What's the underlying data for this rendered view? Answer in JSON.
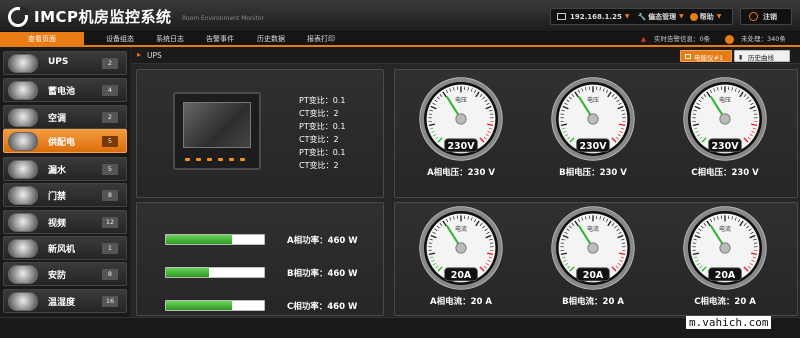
{
  "app": {
    "title": "IMCP机房监控系统",
    "subtitle": "Room Environment Monitor"
  },
  "topbar": {
    "ip": "192.168.1.25",
    "ip_arrow": "▼",
    "settings": "偏态管理",
    "settings_arrow": "▼",
    "help": "帮助",
    "help_arrow": "▼",
    "logout": "注销"
  },
  "nav": {
    "items": [
      "查看页面",
      "设备组态",
      "系统日志",
      "告警事件",
      "历史数据",
      "报表打印"
    ]
  },
  "alarm": {
    "realtime": "实时告警信息：0条",
    "unhandled": "未处理：340条"
  },
  "sidebar": {
    "items": [
      {
        "label": "UPS",
        "count": "2"
      },
      {
        "label": "蓄电池",
        "count": "4"
      },
      {
        "label": "空调",
        "count": "2"
      },
      {
        "label": "供配电",
        "count": "5"
      },
      {
        "label": "漏水",
        "count": "5"
      },
      {
        "label": "门禁",
        "count": "8"
      },
      {
        "label": "视频",
        "count": "12"
      },
      {
        "label": "新风机",
        "count": "1"
      },
      {
        "label": "安防",
        "count": "8"
      },
      {
        "label": "温湿度",
        "count": "16"
      }
    ]
  },
  "breadcrumb": {
    "arrow": "▸",
    "title": "UPS",
    "meter_tab": "电能仪#1",
    "history_tab": "历史曲线"
  },
  "ct_info": [
    "PT变比：0.1",
    "CT变比：2",
    "PT变比：0.1",
    "CT变比：2",
    "PT变比：0.1",
    "CT变比：2"
  ],
  "power": [
    {
      "label": "A相功率：460 W",
      "fill": 0.67
    },
    {
      "label": "B相功率：460 W",
      "fill": 0.44
    },
    {
      "label": "C相功率：460 W",
      "fill": 0.67
    }
  ],
  "voltage_gauges": [
    {
      "title": "电压",
      "value": "230V",
      "label": "A相电压：230 V",
      "needle": 0.38
    },
    {
      "title": "电压",
      "value": "230V",
      "label": "B相电压：230 V",
      "needle": 0.38
    },
    {
      "title": "电压",
      "value": "230V",
      "label": "C相电压：230 V",
      "needle": 0.38
    }
  ],
  "current_gauges": [
    {
      "title": "电流",
      "value": "20A",
      "label": "A相电流：20 A",
      "needle": 0.38
    },
    {
      "title": "电流",
      "value": "20A",
      "label": "B相电流：20 A",
      "needle": 0.38
    },
    {
      "title": "电流",
      "value": "20A",
      "label": "C相电流：20 A",
      "needle": 0.38
    }
  ],
  "watermark": "m.vahich.com",
  "colors": {
    "accent": "#e87c14",
    "gauge_needle": "#2fb52f",
    "bar_fill": "#3fae30"
  },
  "icons": {
    "ups": "ups-icon",
    "battery": "battery-icon",
    "aircon": "aircon-icon",
    "power": "power-icon",
    "leak": "leak-icon",
    "access": "door-icon",
    "video": "camera-icon",
    "fresh_air": "fan-icon",
    "security": "alarm-icon",
    "thermo": "thermometer-icon"
  }
}
